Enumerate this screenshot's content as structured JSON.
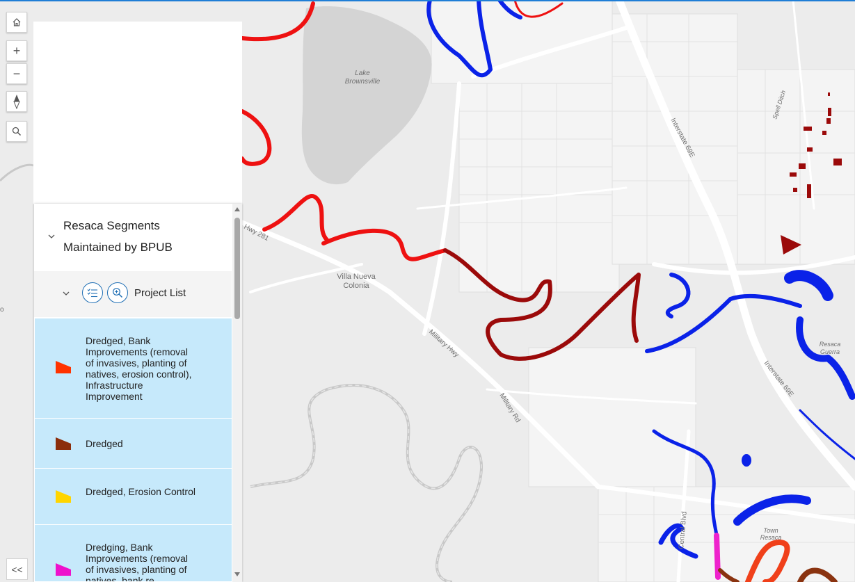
{
  "map": {
    "labels": {
      "lake": "Lake\nBrownsville",
      "villa": "Villa Nueva\nColonia",
      "hwy281": "Hwy 281",
      "militaryHwy": "Military Hwy",
      "militaryRd": "Military Rd",
      "interstate1": "Interstate 69E",
      "interstate2": "Interstate 69E",
      "spellDitch": "Spell Ditch",
      "centralBlvd": "Central Blvd",
      "resacaGuerra": "Resaca\nGuerra",
      "townResaca": "Town\nResaca",
      "leftEdge": "o"
    },
    "colors": {
      "red": "#ee1111",
      "darkRed": "#9b0a0a",
      "blue": "#0a22e8",
      "orange": "#f0401a",
      "magenta": "#ee22cc",
      "brown": "#8a3310"
    }
  },
  "toolbar": {
    "home": "home-icon",
    "zoomIn": "+",
    "zoomOut": "−",
    "compass": "compass-icon",
    "search": "search-icon"
  },
  "legend": {
    "layer_title": "Resaca Segments Maintained by BPUB",
    "sub_layer": "Project List",
    "items": [
      {
        "label": "Dredged, Bank Improvements (removal of invasives, planting of natives, erosion control), Infrastructure Improvement",
        "color": "#ff3300"
      },
      {
        "label": "Dredged",
        "color": "#8b2e0c"
      },
      {
        "label": "Dredged, Erosion Control",
        "color": "#ffd500"
      },
      {
        "label": "Dredging, Bank Improvements (removal of invasives, planting of natives, bank re",
        "color": "#ee11cc"
      }
    ]
  },
  "collapse_label": "<<"
}
